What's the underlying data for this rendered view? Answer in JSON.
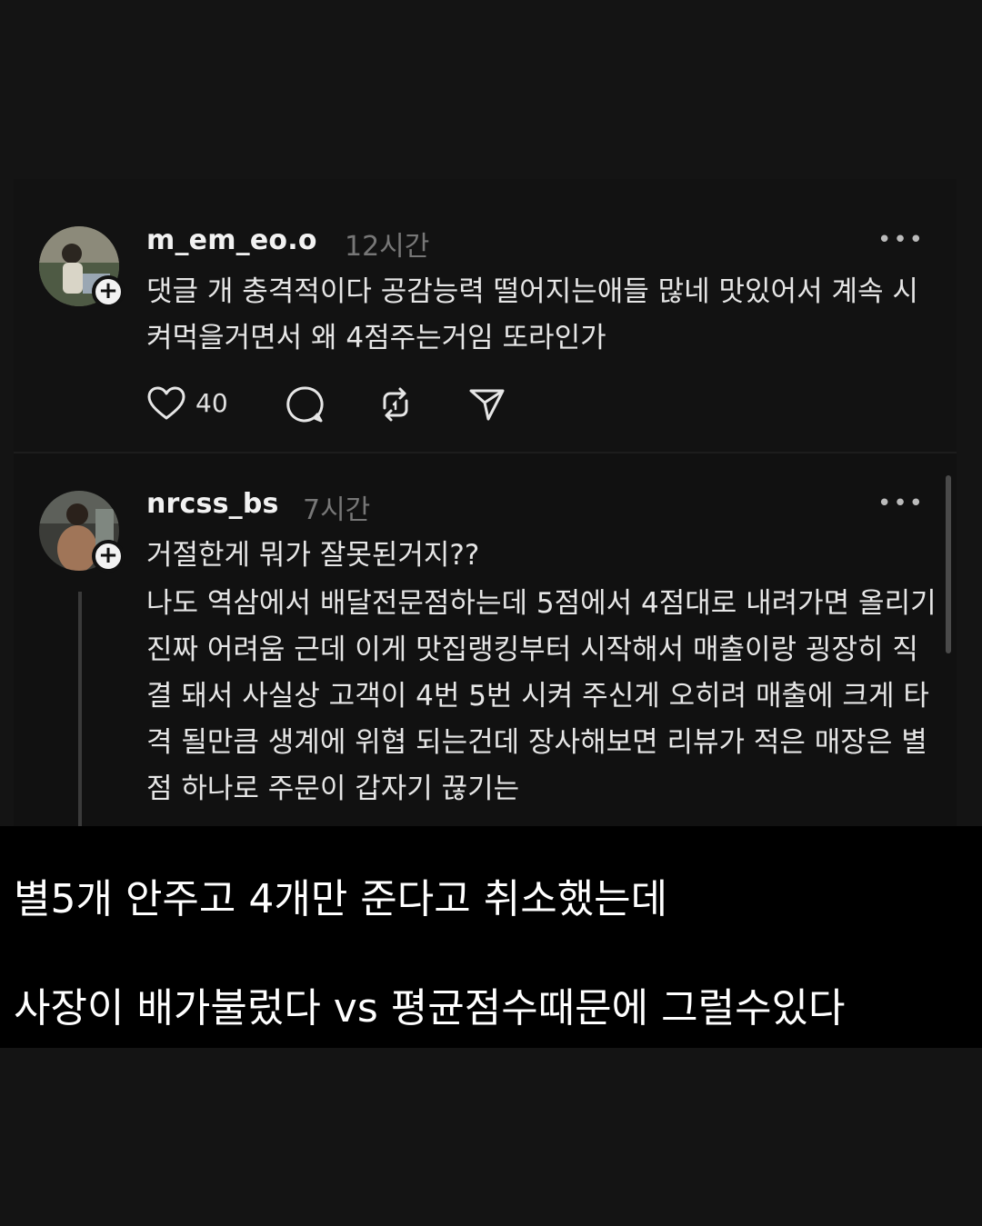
{
  "posts": [
    {
      "username": "m_em_eo.o",
      "time": "12시간",
      "more": "•••",
      "text": "댓글 개 충격적이다 공감능력 떨어지는애들 많네 맛있어서 계속 시켜먹을거면서 왜 4점주는거임 또라인가",
      "likes": "40",
      "icons": [
        "heart-icon",
        "comment-icon",
        "repost-icon",
        "share-icon"
      ]
    },
    {
      "username": "nrcss_bs",
      "time": "7시간",
      "more": "•••",
      "text_line1": "거절한게 뭐가 잘못된거지??",
      "text_body": "나도 역삼에서 배달전문점하는데 5점에서 4점대로 내려가면 올리기 진짜 어려움 근데 이게 맛집랭킹부터 시작해서 매출이랑 굉장히 직결 돼서 사실상 고객이 4번 5번 시켜 주신게 오히려 매출에 크게 타격 될만큼 생계에 위협 되는건데 장사해보면 리뷰가 적은 매장은 별점 하나로 주문이 갑자기 끊기는"
    }
  ],
  "caption": {
    "line1": "별5개 안주고 4개만 준다고 취소했는데",
    "line2": "사장이 배가불렀다 vs 평균점수때문에 그럴수있다"
  },
  "colors": {
    "background": "#141414",
    "caption_background": "#000000",
    "text": "#e6e6e6",
    "muted": "#777777"
  }
}
